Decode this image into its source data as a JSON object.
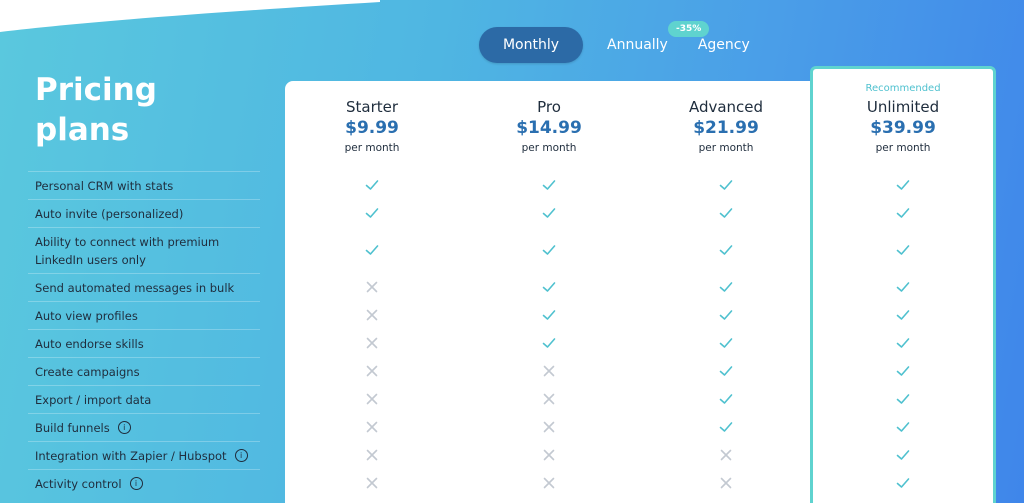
{
  "toggle": {
    "monthly": "Monthly",
    "annually": "Annually",
    "agency": "Agency",
    "discount": "-35%"
  },
  "title": "Pricing plans",
  "recommended": "Recommended",
  "plans": [
    {
      "name": "Starter",
      "price": "$9.99",
      "per": "per month"
    },
    {
      "name": "Pro",
      "price": "$14.99",
      "per": "per month"
    },
    {
      "name": "Advanced",
      "price": "$21.99",
      "per": "per month"
    },
    {
      "name": "Unlimited",
      "price": "$39.99",
      "per": "per month"
    }
  ],
  "features": [
    {
      "label": "Personal CRM with stats",
      "info": false,
      "marks": [
        true,
        true,
        true,
        true
      ]
    },
    {
      "label": "Auto invite (personalized)",
      "info": false,
      "marks": [
        true,
        true,
        true,
        true
      ]
    },
    {
      "label": "Ability to connect with premium LinkedIn users only",
      "info": false,
      "marks": [
        true,
        true,
        true,
        true
      ]
    },
    {
      "label": "Send automated messages in bulk",
      "info": false,
      "marks": [
        false,
        true,
        true,
        true
      ]
    },
    {
      "label": "Auto view profiles",
      "info": false,
      "marks": [
        false,
        true,
        true,
        true
      ]
    },
    {
      "label": "Auto endorse skills",
      "info": false,
      "marks": [
        false,
        true,
        true,
        true
      ]
    },
    {
      "label": "Create campaigns",
      "info": false,
      "marks": [
        false,
        false,
        true,
        true
      ]
    },
    {
      "label": "Export / import data",
      "info": false,
      "marks": [
        false,
        false,
        true,
        true
      ]
    },
    {
      "label": "Build funnels",
      "info": true,
      "marks": [
        false,
        false,
        true,
        true
      ]
    },
    {
      "label": "Integration with Zapier / Hubspot",
      "info": true,
      "marks": [
        false,
        false,
        false,
        true
      ]
    },
    {
      "label": "Activity control",
      "info": true,
      "marks": [
        false,
        false,
        false,
        true
      ]
    }
  ],
  "colors": {
    "check": "#4fc1cf",
    "cross": "#c3c9d1",
    "price": "#2a6fb0",
    "accent": "#5fd3cf"
  }
}
